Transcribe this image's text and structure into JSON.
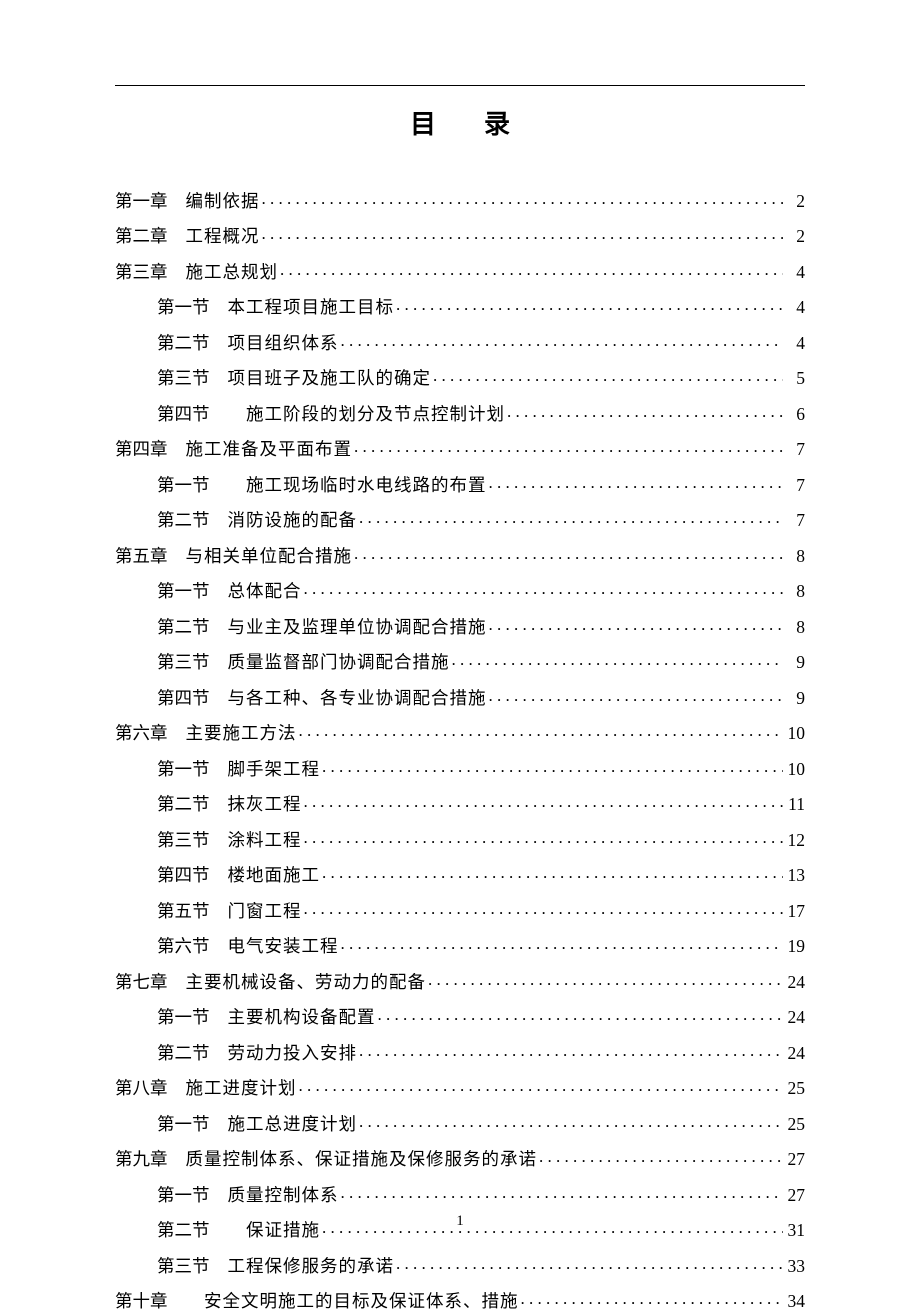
{
  "title": "目录",
  "footer_page": "1",
  "toc": [
    {
      "level": 1,
      "chapter": "第一章",
      "title": "编制依据",
      "page": "2"
    },
    {
      "level": 1,
      "chapter": "第二章",
      "title": "工程概况",
      "page": "2"
    },
    {
      "level": 1,
      "chapter": "第三章",
      "title": "施工总规划",
      "page": "4"
    },
    {
      "level": 2,
      "chapter": "第一节",
      "title": "本工程项目施工目标",
      "page": "4"
    },
    {
      "level": 2,
      "chapter": "第二节",
      "title": "项目组织体系",
      "page": "4"
    },
    {
      "level": 2,
      "chapter": "第三节",
      "title": "项目班子及施工队的确定",
      "page": "5"
    },
    {
      "level": 2,
      "chapter": "第四节",
      "title": "　施工阶段的划分及节点控制计划",
      "page": "6"
    },
    {
      "level": 1,
      "chapter": "第四章",
      "title": "施工准备及平面布置",
      "page": "7"
    },
    {
      "level": 2,
      "chapter": "第一节",
      "title": "　施工现场临时水电线路的布置",
      "page": "7"
    },
    {
      "level": 2,
      "chapter": "第二节",
      "title": "消防设施的配备",
      "page": "7"
    },
    {
      "level": 1,
      "chapter": "第五章",
      "title": "与相关单位配合措施",
      "page": "8"
    },
    {
      "level": 2,
      "chapter": "第一节",
      "title": "总体配合",
      "page": "8"
    },
    {
      "level": 2,
      "chapter": "第二节",
      "title": "与业主及监理单位协调配合措施",
      "page": "8"
    },
    {
      "level": 2,
      "chapter": "第三节",
      "title": "质量监督部门协调配合措施",
      "page": "9"
    },
    {
      "level": 2,
      "chapter": "第四节",
      "title": "与各工种、各专业协调配合措施",
      "page": "9"
    },
    {
      "level": 1,
      "chapter": "第六章",
      "title": "主要施工方法",
      "page": "10"
    },
    {
      "level": 2,
      "chapter": "第一节",
      "title": "脚手架工程",
      "page": "10"
    },
    {
      "level": 2,
      "chapter": "第二节",
      "title": "抹灰工程",
      "page": "11"
    },
    {
      "level": 2,
      "chapter": "第三节",
      "title": "涂料工程",
      "page": "12"
    },
    {
      "level": 2,
      "chapter": "第四节",
      "title": "楼地面施工",
      "page": "13"
    },
    {
      "level": 2,
      "chapter": "第五节",
      "title": "门窗工程",
      "page": "17"
    },
    {
      "level": 2,
      "chapter": "第六节",
      "title": "电气安装工程",
      "page": "19"
    },
    {
      "level": 1,
      "chapter": "第七章",
      "title": "主要机械设备、劳动力的配备",
      "page": "24"
    },
    {
      "level": 2,
      "chapter": "第一节",
      "title": "主要机构设备配置",
      "page": "24"
    },
    {
      "level": 2,
      "chapter": "第二节",
      "title": "劳动力投入安排",
      "page": "24"
    },
    {
      "level": 1,
      "chapter": "第八章",
      "title": "施工进度计划",
      "page": "25"
    },
    {
      "level": 2,
      "chapter": "第一节",
      "title": "施工总进度计划",
      "page": "25"
    },
    {
      "level": 1,
      "chapter": "第九章",
      "title": "质量控制体系、保证措施及保修服务的承诺",
      "page": "27"
    },
    {
      "level": 2,
      "chapter": "第一节",
      "title": "质量控制体系",
      "page": "27"
    },
    {
      "level": 2,
      "chapter": "第二节",
      "title": "　保证措施",
      "page": "31"
    },
    {
      "level": 2,
      "chapter": "第三节",
      "title": "工程保修服务的承诺",
      "page": "33"
    },
    {
      "level": 1,
      "chapter": "第十章",
      "title": "　安全文明施工的目标及保证体系、措施",
      "page": "34"
    }
  ]
}
